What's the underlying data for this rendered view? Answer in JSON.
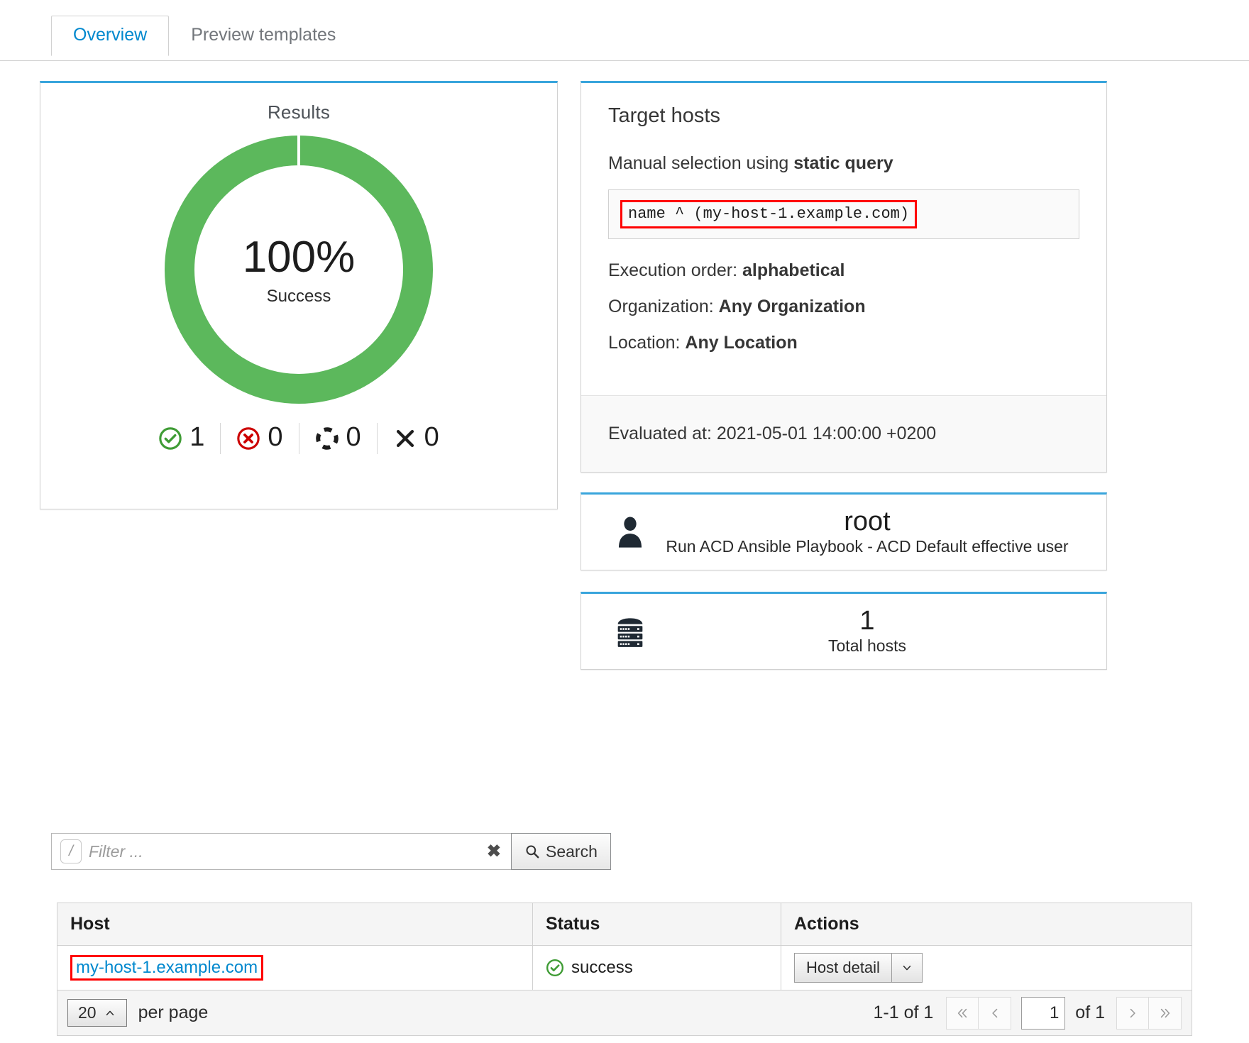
{
  "tabs": [
    {
      "label": "Overview",
      "active": true
    },
    {
      "label": "Preview templates",
      "active": false
    }
  ],
  "results": {
    "title": "Results",
    "percent": "100%",
    "percent_label": "Success",
    "legend": [
      {
        "icon": "check-circle-icon",
        "count": "1",
        "color": "#3f9c35"
      },
      {
        "icon": "error-circle-icon",
        "count": "0",
        "color": "#cc0000"
      },
      {
        "icon": "pending-dashed-circle-icon",
        "count": "0",
        "color": "#1d1d1d"
      },
      {
        "icon": "cancelled-x-icon",
        "count": "0",
        "color": "#1d1d1d"
      }
    ]
  },
  "chart_data": {
    "type": "pie",
    "title": "Results",
    "center_value": "100%",
    "center_label": "Success",
    "categories": [
      "Success",
      "Failed",
      "Pending",
      "Cancelled"
    ],
    "values": [
      1,
      0,
      0,
      0
    ],
    "percentages": [
      100,
      0,
      0,
      0
    ],
    "colors": [
      "#5cb85c",
      "#cc0000",
      "#1d1d1d",
      "#1d1d1d"
    ],
    "legend_position": "bottom",
    "grid": false
  },
  "target_hosts": {
    "title": "Target hosts",
    "selection_prefix": "Manual selection using ",
    "selection_mode": "static query",
    "query": "name ^ (my-host-1.example.com)",
    "execution_order_label": "Execution order: ",
    "execution_order_value": "alphabetical",
    "organization_label": "Organization: ",
    "organization_value": "Any Organization",
    "location_label": "Location: ",
    "location_value": "Any Location",
    "evaluated_at": "Evaluated at: 2021-05-01 14:00:00 +0200"
  },
  "user_card": {
    "icon": "user-icon",
    "name": "root",
    "description": "Run ACD Ansible Playbook - ACD Default effective user"
  },
  "hosts_card": {
    "icon": "server-rack-icon",
    "count": "1",
    "label": "Total hosts"
  },
  "filter": {
    "shortcut_badge": "/",
    "placeholder": "Filter ...",
    "value": "",
    "clear_icon": "clear-x-icon",
    "search_button": "Search",
    "search_icon": "search-icon"
  },
  "table": {
    "columns": [
      "Host",
      "Status",
      "Actions"
    ],
    "rows": [
      {
        "host": "my-host-1.example.com",
        "status": "success",
        "status_icon": "check-circle-icon",
        "action_label": "Host detail",
        "action_caret": "chevron-down-icon"
      }
    ]
  },
  "pagination": {
    "per_page_value": "20",
    "per_page_caret": "chevron-up-icon",
    "per_page_label": "per page",
    "range_text": "1-1 of 1",
    "first_icon": "double-chevron-left-icon",
    "prev_icon": "chevron-left-icon",
    "page_value": "1",
    "of_text": "of 1",
    "next_icon": "chevron-right-icon",
    "last_icon": "double-chevron-right-icon"
  },
  "colors": {
    "accent_blue": "#39a5dc",
    "link_blue": "#0088ce",
    "success_green": "#5cb85c",
    "danger_red": "#cc0000",
    "highlight_red": "#ff0000"
  }
}
